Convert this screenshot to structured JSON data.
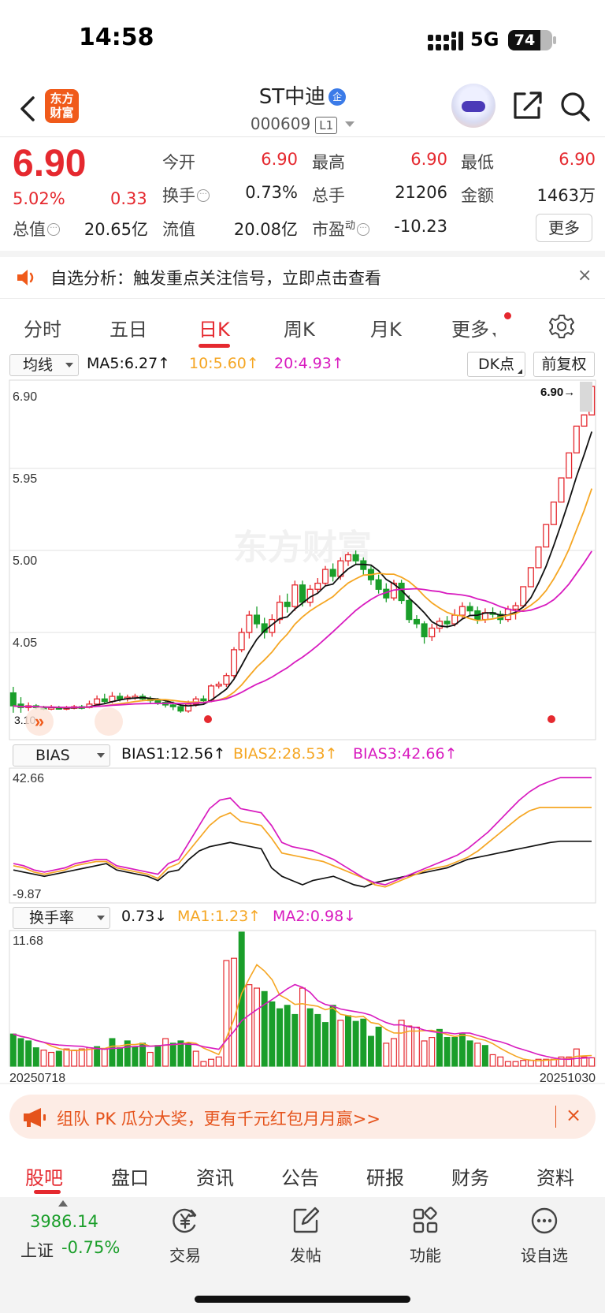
{
  "status_bar": {
    "time": "14:58",
    "network": "5G",
    "battery": "74",
    "battery_level": 0.74
  },
  "header": {
    "brand_logo": "东方财富",
    "title": "ST中迪",
    "title_badge": "企",
    "code": "000609",
    "level_badge": "L1"
  },
  "quote": {
    "price": "6.90",
    "change_pct": "5.02%",
    "change_abs": "0.33",
    "stats": [
      {
        "label": "今开",
        "value": "6.90",
        "color": "red",
        "info": false
      },
      {
        "label": "最高",
        "value": "6.90",
        "color": "red",
        "info": false
      },
      {
        "label": "最低",
        "value": "6.90",
        "color": "red",
        "info": false
      },
      {
        "label": "换手",
        "value": "0.73%",
        "color": "black",
        "info": true
      },
      {
        "label": "总手",
        "value": "21206",
        "color": "black",
        "info": false
      },
      {
        "label": "金额",
        "value": "1463万",
        "color": "black",
        "info": false
      },
      {
        "label": "总值",
        "value": "20.65亿",
        "color": "black",
        "info": true
      },
      {
        "label": "流值",
        "value": "20.08亿",
        "color": "black",
        "info": false
      },
      {
        "label": "市盈",
        "label_sup": "动",
        "value": "-10.23",
        "color": "black",
        "info": true
      }
    ],
    "more_button": "更多"
  },
  "alert": {
    "text": "自选分析：触发重点关注信号，立即点击查看",
    "close": "×"
  },
  "period_tabs": [
    "分时",
    "五日",
    "日K",
    "周K",
    "月K",
    "更多"
  ],
  "ma_row": {
    "selector": "均线",
    "ma5": "MA5:6.27↑",
    "ma10": "10:5.60↑",
    "ma20": "20:4.93↑",
    "dk_button": "DK点",
    "adjust_button": "前复权"
  },
  "bias_row": {
    "selector": "BIAS",
    "bias1": "BIAS1:12.56↑",
    "bias2": "BIAS2:28.53↑",
    "bias3": "BIAS3:42.66↑"
  },
  "turnover_row": {
    "selector": "换手率",
    "value": "0.73↓",
    "ma1": "MA1:1.23↑",
    "ma2": "MA2:0.98↓"
  },
  "chart_data": [
    {
      "type": "candlestick",
      "title": "",
      "y_ticks": [
        "6.90",
        "5.95",
        "5.00",
        "4.05"
      ],
      "ylim": [
        3.1,
        6.9
      ],
      "last_price_label": "6.90",
      "low_marker_label": "3.10",
      "watermark": "东方财富",
      "colors": {
        "up": "#e5292f",
        "down": "#1a9e2a",
        "ma5": "#111111",
        "ma10": "#f5a623",
        "ma20": "#d81bbf"
      },
      "candles": [
        [
          3.35,
          3.2,
          3.42,
          3.12
        ],
        [
          3.22,
          3.18,
          3.3,
          3.12
        ],
        [
          3.18,
          3.2,
          3.24,
          3.14
        ],
        [
          3.2,
          3.18,
          3.22,
          3.16
        ],
        [
          3.18,
          3.17,
          3.2,
          3.15
        ],
        [
          3.17,
          3.18,
          3.21,
          3.15
        ],
        [
          3.18,
          3.17,
          3.2,
          3.16
        ],
        [
          3.17,
          3.18,
          3.2,
          3.15
        ],
        [
          3.18,
          3.19,
          3.21,
          3.16
        ],
        [
          3.19,
          3.18,
          3.21,
          3.16
        ],
        [
          3.18,
          3.22,
          3.26,
          3.17
        ],
        [
          3.22,
          3.28,
          3.32,
          3.2
        ],
        [
          3.28,
          3.25,
          3.34,
          3.22
        ],
        [
          3.25,
          3.31,
          3.36,
          3.23
        ],
        [
          3.31,
          3.28,
          3.35,
          3.25
        ],
        [
          3.28,
          3.3,
          3.33,
          3.25
        ],
        [
          3.3,
          3.31,
          3.34,
          3.27
        ],
        [
          3.31,
          3.28,
          3.34,
          3.26
        ],
        [
          3.28,
          3.26,
          3.31,
          3.23
        ],
        [
          3.26,
          3.24,
          3.29,
          3.21
        ],
        [
          3.24,
          3.21,
          3.27,
          3.18
        ],
        [
          3.21,
          3.19,
          3.25,
          3.15
        ],
        [
          3.19,
          3.14,
          3.22,
          3.12
        ],
        [
          3.14,
          3.22,
          3.26,
          3.12
        ],
        [
          3.22,
          3.28,
          3.31,
          3.19
        ],
        [
          3.28,
          3.26,
          3.32,
          3.22
        ],
        [
          3.26,
          3.43,
          3.45,
          3.24
        ],
        [
          3.43,
          3.45,
          3.48,
          3.4
        ],
        [
          3.45,
          3.55,
          3.58,
          3.42
        ],
        [
          3.55,
          3.85,
          3.88,
          3.52
        ],
        [
          3.85,
          4.05,
          4.1,
          3.82
        ],
        [
          4.05,
          4.25,
          4.3,
          3.98
        ],
        [
          4.25,
          4.15,
          4.35,
          4.1
        ],
        [
          4.15,
          4.05,
          4.22,
          3.98
        ],
        [
          4.05,
          4.2,
          4.26,
          4.0
        ],
        [
          4.2,
          4.4,
          4.48,
          4.15
        ],
        [
          4.4,
          4.35,
          4.5,
          4.28
        ],
        [
          4.35,
          4.6,
          4.65,
          4.3
        ],
        [
          4.6,
          4.4,
          4.65,
          4.35
        ],
        [
          4.4,
          4.55,
          4.6,
          4.35
        ],
        [
          4.55,
          4.62,
          4.68,
          4.5
        ],
        [
          4.62,
          4.78,
          4.82,
          4.58
        ],
        [
          4.78,
          4.7,
          4.85,
          4.64
        ],
        [
          4.7,
          4.88,
          4.92,
          4.66
        ],
        [
          4.88,
          4.95,
          4.98,
          4.82
        ],
        [
          4.95,
          4.88,
          5.0,
          4.83
        ],
        [
          4.88,
          4.78,
          4.92,
          4.72
        ],
        [
          4.78,
          4.66,
          4.82,
          4.6
        ],
        [
          4.66,
          4.55,
          4.72,
          4.5
        ],
        [
          4.55,
          4.45,
          4.62,
          4.4
        ],
        [
          4.45,
          4.62,
          4.66,
          4.42
        ],
        [
          4.62,
          4.42,
          4.66,
          4.38
        ],
        [
          4.42,
          4.2,
          4.48,
          4.16
        ],
        [
          4.2,
          4.15,
          4.25,
          4.1
        ],
        [
          4.15,
          4.0,
          4.18,
          3.92
        ],
        [
          4.0,
          4.1,
          4.15,
          3.95
        ],
        [
          4.1,
          4.18,
          4.22,
          4.05
        ],
        [
          4.18,
          4.15,
          4.24,
          4.1
        ],
        [
          4.15,
          4.25,
          4.32,
          4.12
        ],
        [
          4.25,
          4.35,
          4.4,
          4.2
        ],
        [
          4.35,
          4.3,
          4.4,
          4.24
        ],
        [
          4.3,
          4.2,
          4.35,
          4.15
        ],
        [
          4.2,
          4.28,
          4.33,
          4.16
        ],
        [
          4.28,
          4.26,
          4.34,
          4.22
        ],
        [
          4.26,
          4.2,
          4.3,
          4.15
        ],
        [
          4.2,
          4.32,
          4.36,
          4.17
        ],
        [
          4.32,
          4.36,
          4.4,
          4.2
        ],
        [
          4.36,
          4.58,
          4.58,
          4.36
        ],
        [
          4.58,
          4.8,
          4.8,
          4.58
        ],
        [
          4.8,
          5.04,
          5.04,
          4.8
        ],
        [
          5.04,
          5.3,
          5.3,
          5.04
        ],
        [
          5.3,
          5.56,
          5.56,
          5.3
        ],
        [
          5.56,
          5.84,
          5.84,
          5.56
        ],
        [
          5.84,
          6.13,
          6.13,
          5.84
        ],
        [
          6.13,
          6.44,
          6.44,
          6.13
        ],
        [
          6.44,
          6.57,
          6.57,
          6.44
        ],
        [
          6.57,
          6.9,
          6.9,
          6.57
        ]
      ]
    },
    {
      "type": "line",
      "title": "BIAS",
      "y_ticks": [
        "42.66",
        "-9.87"
      ],
      "ylim": [
        -9.87,
        42.66
      ],
      "series": [
        {
          "name": "BIAS1",
          "values": [
            -1,
            -2,
            -3,
            -4,
            -3,
            -2,
            -1,
            0,
            1,
            2,
            -1,
            -2,
            -3,
            -4,
            -6,
            -2,
            -1,
            4,
            8,
            10,
            11,
            12,
            11,
            10,
            9,
            0,
            -4,
            -6,
            -8,
            -6,
            -5,
            -4,
            -6,
            -8,
            -9,
            -7,
            -6,
            -5,
            -4,
            -3,
            -2,
            -1,
            0,
            2,
            4,
            5,
            6,
            7,
            8,
            9,
            10,
            11,
            12,
            12.56,
            12.56,
            12.56,
            12.56
          ]
        },
        {
          "name": "BIAS2",
          "values": [
            1,
            0,
            -2,
            -3,
            -2,
            -1,
            1,
            2,
            3,
            3,
            0,
            -1,
            -2,
            -3,
            -5,
            0,
            2,
            8,
            14,
            20,
            24,
            26,
            22,
            21,
            20,
            14,
            7,
            6,
            5,
            4,
            3,
            1,
            -1,
            -3,
            -5,
            -8,
            -9,
            -7,
            -5,
            -3,
            -1,
            0,
            1,
            3,
            5,
            8,
            12,
            16,
            20,
            24,
            27,
            28.53,
            28.53,
            28.53,
            28.53,
            28.53,
            28.53
          ]
        },
        {
          "name": "BIAS3",
          "values": [
            2,
            1,
            -1,
            -2,
            -1,
            0,
            2,
            3,
            4,
            4,
            1,
            0,
            -1,
            -2,
            -3,
            2,
            4,
            12,
            20,
            28,
            32,
            33,
            28,
            27,
            26,
            20,
            12,
            10,
            9,
            8,
            6,
            4,
            1,
            -2,
            -5,
            -7,
            -8,
            -6,
            -4,
            -2,
            0,
            2,
            4,
            6,
            9,
            13,
            17,
            22,
            27,
            32,
            36,
            39,
            41,
            42.66,
            42.66,
            42.66,
            42.66
          ]
        }
      ]
    },
    {
      "type": "bar",
      "title": "换手率",
      "y_ticks": [
        "11.68"
      ],
      "ylim": [
        0,
        11.68
      ],
      "x_start_label": "20250718",
      "x_end_label": "20251030",
      "values": [
        2.8,
        2.4,
        2.2,
        1.6,
        1.4,
        1.2,
        1.3,
        1.5,
        1.4,
        1.5,
        1.6,
        1.7,
        1.5,
        2.4,
        1.6,
        2.2,
        1.7,
        2.0,
        1.2,
        1.8,
        2.4,
        2.0,
        2.2,
        2.0,
        1.3,
        0.4,
        0.6,
        0.8,
        9.2,
        9.4,
        11.68,
        7.1,
        6.8,
        6.5,
        5.6,
        5.0,
        5.3,
        4.5,
        6.8,
        5.0,
        4.5,
        3.8,
        5.3,
        4.0,
        4.4,
        3.9,
        4.1,
        2.6,
        3.4,
        2.0,
        2.4,
        4.0,
        3.5,
        3.4,
        2.2,
        2.5,
        3.2,
        2.5,
        2.5,
        2.8,
        2.2,
        2.0,
        1.8,
        1.0,
        0.8,
        0.4,
        0.4,
        0.5,
        0.5,
        0.6,
        0.6,
        0.6,
        0.8,
        0.8,
        1.5,
        0.8,
        0.73
      ],
      "up_flags": [
        0,
        0,
        0,
        0,
        1,
        1,
        0,
        1,
        1,
        1,
        1,
        0,
        1,
        0,
        0,
        0,
        0,
        0,
        1,
        0,
        1,
        0,
        0,
        0,
        1,
        1,
        1,
        1,
        1,
        1,
        0,
        1,
        1,
        0,
        0,
        0,
        0,
        0,
        1,
        0,
        0,
        0,
        0,
        1,
        0,
        0,
        0,
        0,
        0,
        1,
        1,
        1,
        1,
        1,
        1,
        1,
        0,
        0,
        0,
        0,
        0,
        1,
        0,
        1,
        1,
        1,
        1,
        1,
        1,
        1,
        1,
        1,
        1,
        1,
        1,
        1,
        1
      ],
      "series": [
        {
          "name": "MA1",
          "color": "#f5a623"
        },
        {
          "name": "MA2",
          "color": "#d81bbf"
        }
      ]
    }
  ],
  "promo": {
    "text": "组队 PK 瓜分大奖，更有千元红包月月赢>>",
    "close": "×"
  },
  "bottom_tabs": [
    "股吧",
    "盘口",
    "资讯",
    "公告",
    "研报",
    "财务",
    "资料"
  ],
  "bottom_nav": {
    "index_value": "3986.14",
    "index_name": "上证",
    "index_change": "-0.75%",
    "items": [
      {
        "label": "交易",
        "icon": "yen-icon"
      },
      {
        "label": "发帖",
        "icon": "edit-icon"
      },
      {
        "label": "功能",
        "icon": "grid-icon"
      },
      {
        "label": "设自选",
        "icon": "more-dots-icon"
      }
    ]
  }
}
